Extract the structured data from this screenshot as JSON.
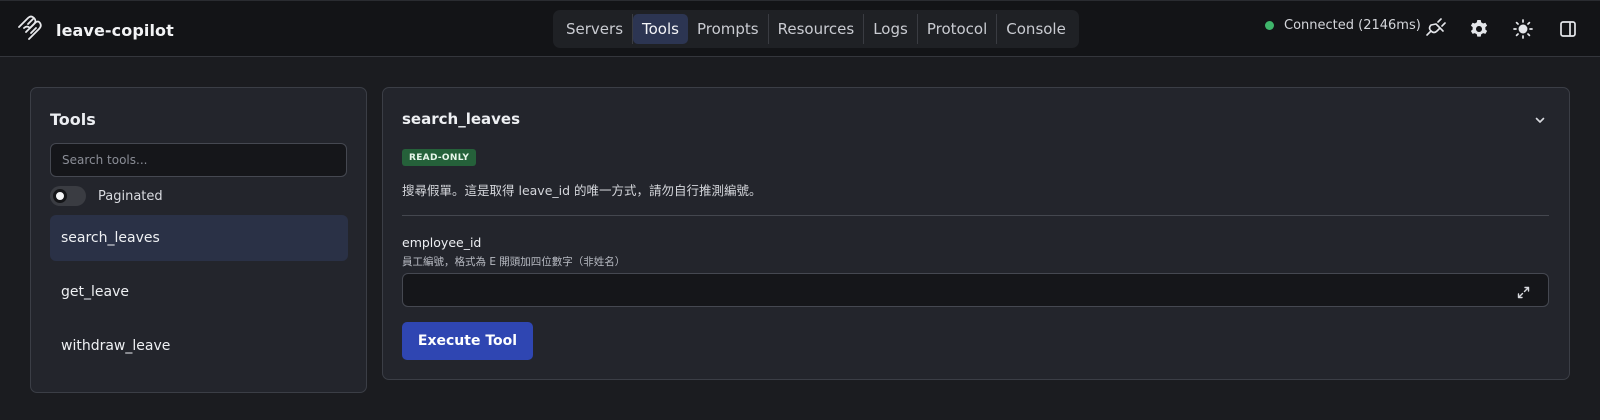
{
  "header": {
    "app_name": "leave-copilot",
    "logo_icon": "mcp-logo-icon",
    "tabs": [
      {
        "label": "Servers",
        "active": false
      },
      {
        "label": "Tools",
        "active": true
      },
      {
        "label": "Prompts",
        "active": false
      },
      {
        "label": "Resources",
        "active": false
      },
      {
        "label": "Logs",
        "active": false
      },
      {
        "label": "Protocol",
        "active": false
      },
      {
        "label": "Console",
        "active": false
      }
    ],
    "status": {
      "text": "Connected (2146ms)",
      "color": "#3fb56b"
    },
    "icons": [
      "plug-icon",
      "gear-icon",
      "sun-icon",
      "sidebar-toggle-icon"
    ]
  },
  "sidebar": {
    "title": "Tools",
    "search_placeholder": "Search tools...",
    "search_value": "",
    "paginated_label": "Paginated",
    "paginated_on": false,
    "tools": [
      {
        "label": "search_leaves",
        "selected": true
      },
      {
        "label": "get_leave",
        "selected": false
      },
      {
        "label": "withdraw_leave",
        "selected": false
      }
    ]
  },
  "main": {
    "tool_name": "search_leaves",
    "badge": "READ-ONLY",
    "badge_color": "#25613a",
    "description": "搜尋假單。這是取得 leave_id 的唯一方式，請勿自行推測編號。",
    "field": {
      "name": "employee_id",
      "description": "員工編號，格式為 E 開頭加四位數字（非姓名）",
      "value": ""
    },
    "execute_label": "Execute Tool",
    "accent_color": "#2f46b2"
  }
}
